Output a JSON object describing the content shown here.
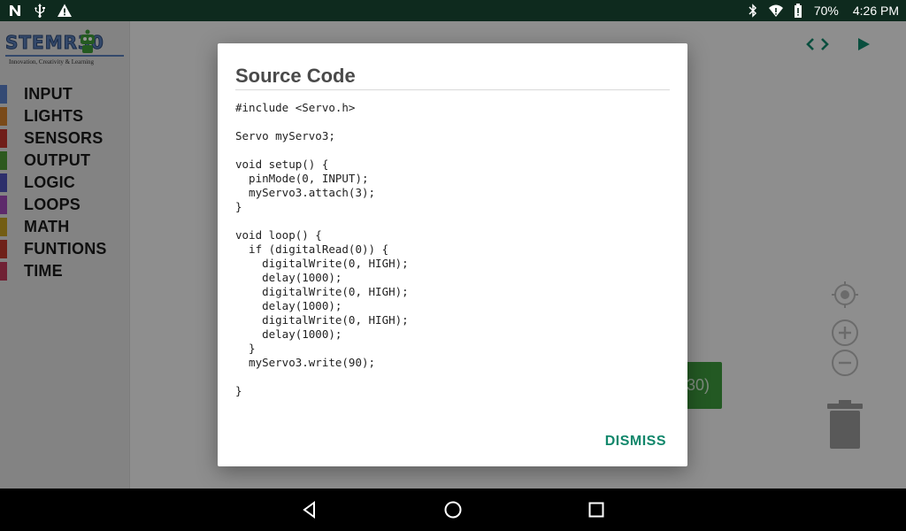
{
  "status_bar": {
    "icons_left": [
      "n-notification-icon",
      "usb-icon",
      "warning-icon"
    ],
    "icons_right": [
      "bluetooth-icon",
      "wifi-icon",
      "battery-icon"
    ],
    "battery": "70%",
    "time": "4:26 PM"
  },
  "sidebar": {
    "logo_text": "STEMR30",
    "logo_tagline": "Innovation, Creativity & Learning",
    "categories": [
      {
        "label": "INPUT",
        "color": "#5b80c8"
      },
      {
        "label": "LIGHTS",
        "color": "#d3802c"
      },
      {
        "label": "SENSORS",
        "color": "#c2352b"
      },
      {
        "label": "OUTPUT",
        "color": "#4f9a35"
      },
      {
        "label": "LOGIC",
        "color": "#4f52b8"
      },
      {
        "label": "LOOPS",
        "color": "#a149b8"
      },
      {
        "label": "MATH",
        "color": "#c7a021"
      },
      {
        "label": "FUNTIONS",
        "color": "#c0392b"
      },
      {
        "label": "TIME",
        "color": "#c23a5a"
      }
    ]
  },
  "workspace": {
    "block_text": "30)",
    "icons": [
      "code-icon",
      "play-icon",
      "recenter-icon",
      "zoom-in-icon",
      "zoom-out-icon",
      "trash-icon"
    ]
  },
  "dialog": {
    "title": "Source Code",
    "code": "#include <Servo.h>\n\nServo myServo3;\n\nvoid setup() {\n  pinMode(0, INPUT);\n  myServo3.attach(3);\n}\n\nvoid loop() {\n  if (digitalRead(0)) {\n    digitalWrite(0, HIGH);\n    delay(1000);\n    digitalWrite(0, HIGH);\n    delay(1000);\n    digitalWrite(0, HIGH);\n    delay(1000);\n  }\n  myServo3.write(90);\n\n}",
    "dismiss_label": "DISMISS"
  },
  "colors": {
    "accent": "#11876b",
    "block_green": "#3d9a3d",
    "status_bar": "#0e2a1e"
  }
}
